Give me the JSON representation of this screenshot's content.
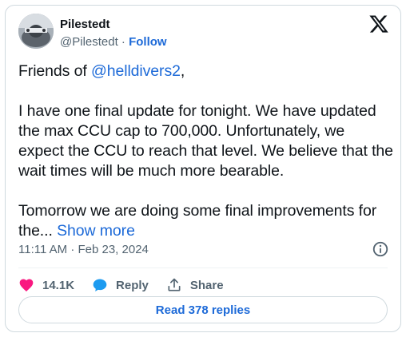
{
  "author": {
    "name": "Pilestedt",
    "handle": "@Pilestedt",
    "separator": " · ",
    "follow_label": "Follow"
  },
  "tweet": {
    "greeting_prefix": "Friends of ",
    "mention": "@helldivers2",
    "greeting_suffix": ",",
    "paragraph_2": "I have one final update for tonight. We have updated the max CCU cap to 700,000. Unfortunately, we expect the CCU to reach that level. We believe that the wait times will be much more bearable.",
    "paragraph_3": "Tomorrow we are doing some final improvements for the...",
    "show_more_label": "Show more"
  },
  "timestamp": "11:11 AM · Feb 23, 2024",
  "actions": {
    "likes": "14.1K",
    "reply_label": "Reply",
    "share_label": "Share"
  },
  "read_replies_label": "Read 378 replies",
  "colors": {
    "link": "#1d6ad8",
    "like": "#f91880",
    "reply_icon": "#1d9bf0",
    "muted": "#536471"
  }
}
